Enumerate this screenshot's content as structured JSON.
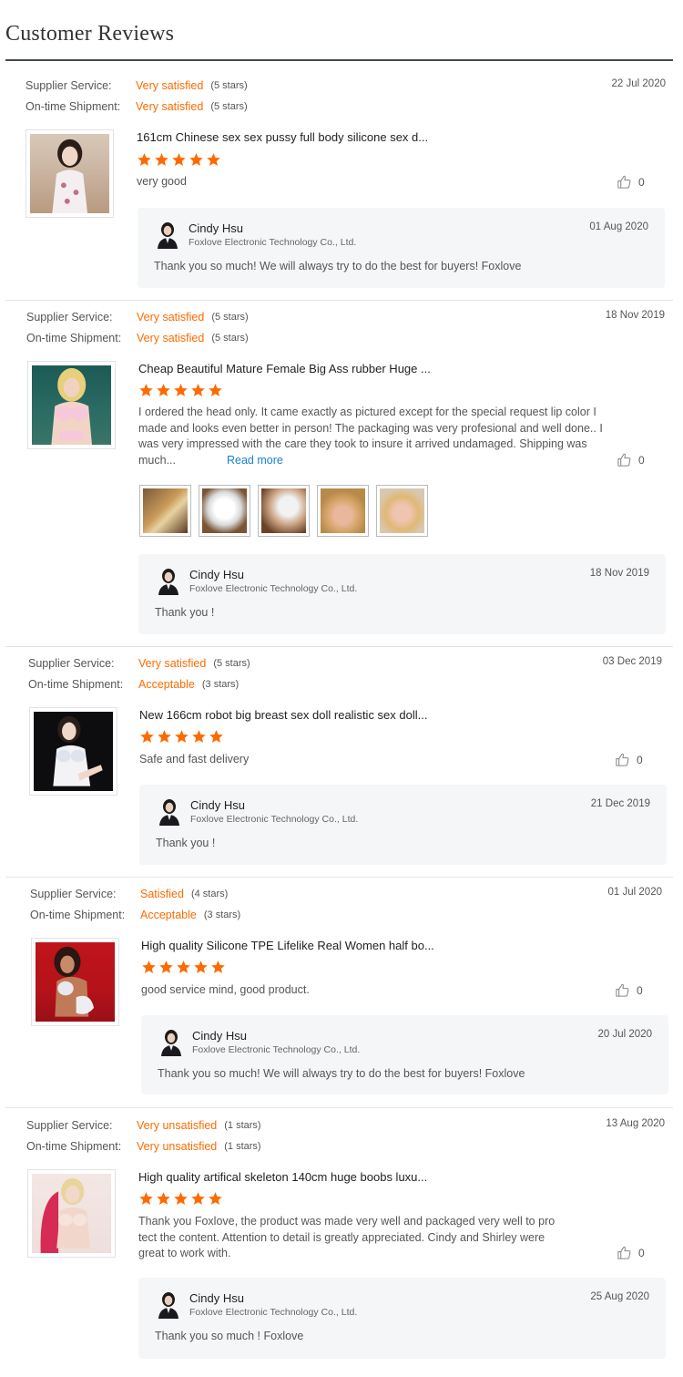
{
  "page": {
    "title": "Customer Reviews"
  },
  "labels": {
    "supplier_service": "Supplier Service:",
    "ontime_shipment": "On-time Shipment:",
    "read_more": "Read more"
  },
  "colors": {
    "accent": "#ff6a00",
    "link": "#1a7fd0",
    "reply_bg": "#f5f6f8"
  },
  "reviews": [
    {
      "supplier_value": "Very satisfied",
      "supplier_stars": "(5 stars)",
      "shipment_value": "Very satisfied",
      "shipment_stars": "(5 stars)",
      "date": "22 Jul 2020",
      "product_title": "161cm Chinese sex sex pussy full body silicone sex d...",
      "product_rating": 5,
      "text": "very good",
      "helpful_count": "0",
      "reply": {
        "name": "Cindy Hsu",
        "company": "Foxlove Electronic Technology Co., Ltd.",
        "date": "01 Aug 2020",
        "text": "Thank you so much! We will always try to do the best for buyers! Foxlove"
      }
    },
    {
      "supplier_value": "Very satisfied",
      "supplier_stars": "(5 stars)",
      "shipment_value": "Very satisfied",
      "shipment_stars": "(5 stars)",
      "date": "18 Nov 2019",
      "product_title": "Cheap Beautiful Mature Female Big Ass rubber Huge ...",
      "product_rating": 5,
      "text_lines": [
        "I ordered the head only. It came exactly as pictured except for the special request lip color I",
        "made and looks even better in person! The packaging was very profesional and well done.. I",
        "was very impressed with the care they took to insure it arrived undamaged.  Shipping was",
        "much..."
      ],
      "helpful_count": "0",
      "photo_count": 5,
      "reply": {
        "name": "Cindy Hsu",
        "company": "Foxlove Electronic Technology Co., Ltd.",
        "date": "18 Nov 2019",
        "text": "Thank you !"
      }
    },
    {
      "supplier_value": "Very satisfied",
      "supplier_stars": "(5 stars)",
      "shipment_value": "Acceptable",
      "shipment_stars": "(3 stars)",
      "date": "03 Dec 2019",
      "product_title": "New 166cm robot big breast sex doll realistic sex doll...",
      "product_rating": 5,
      "text": "Safe and fast delivery",
      "helpful_count": "0",
      "reply": {
        "name": "Cindy Hsu",
        "company": "Foxlove Electronic Technology Co., Ltd.",
        "date": "21 Dec 2019",
        "text": "Thank you !"
      }
    },
    {
      "supplier_value": "Satisfied",
      "supplier_stars": "(4 stars)",
      "shipment_value": "Acceptable",
      "shipment_stars": "(3 stars)",
      "date": "01 Jul 2020",
      "product_title": "High quality Silicone TPE Lifelike Real Women half bo...",
      "product_rating": 5,
      "text": "good service mind, good product.",
      "helpful_count": "0",
      "reply": {
        "name": "Cindy Hsu",
        "company": "Foxlove Electronic Technology Co., Ltd.",
        "date": "20 Jul 2020",
        "text": "Thank you so much! We will always try to do the best for buyers! Foxlove"
      }
    },
    {
      "supplier_value": "Very unsatisfied",
      "supplier_stars": "(1 stars)",
      "shipment_value": "Very unsatisfied",
      "shipment_stars": "(1 stars)",
      "date": "13 Aug 2020",
      "product_title": "High quality artifical skeleton 140cm huge boobs luxu...",
      "product_rating": 5,
      "text_lines": [
        "Thank you Foxlove, the product was made very well and packaged very well to pro",
        "tect the content. Attention to detail is greatly appreciated. Cindy and Shirley were",
        "great to work with."
      ],
      "helpful_count": "0",
      "reply": {
        "name": "Cindy Hsu",
        "company": "Foxlove Electronic Technology Co., Ltd.",
        "date": "25 Aug 2020",
        "text": "Thank you so much  ! Foxlove"
      }
    }
  ]
}
